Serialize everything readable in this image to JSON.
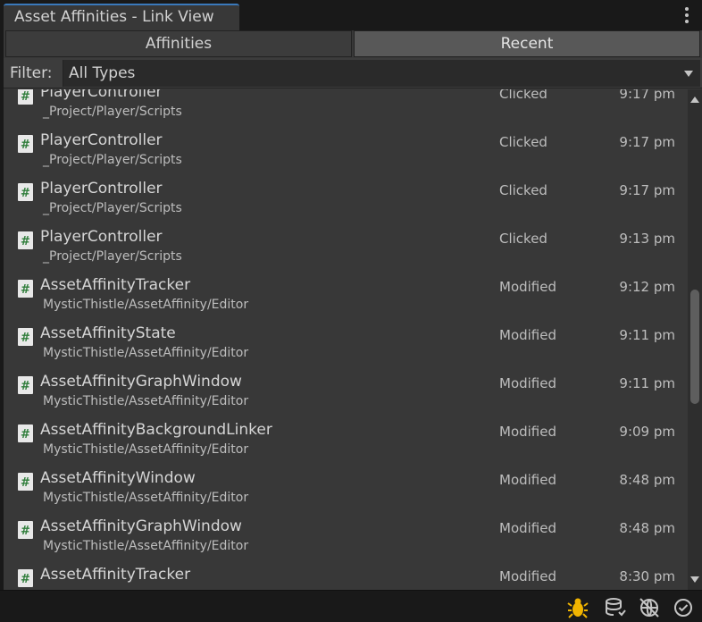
{
  "window": {
    "title": "Asset Affinities - Link View"
  },
  "tabs": {
    "affinities": "Affinities",
    "recent": "Recent",
    "active": "Recent"
  },
  "filter": {
    "label": "Filter:",
    "value": "All Types"
  },
  "rows": [
    {
      "name": "PlayerController",
      "path": "_Project/Player/Scripts",
      "action": "Clicked",
      "time": "9:17 pm",
      "icon": "csharp-script-icon"
    },
    {
      "name": "PlayerController",
      "path": "_Project/Player/Scripts",
      "action": "Clicked",
      "time": "9:17 pm",
      "icon": "csharp-script-icon"
    },
    {
      "name": "PlayerController",
      "path": "_Project/Player/Scripts",
      "action": "Clicked",
      "time": "9:17 pm",
      "icon": "csharp-script-icon"
    },
    {
      "name": "PlayerController",
      "path": "_Project/Player/Scripts",
      "action": "Clicked",
      "time": "9:13 pm",
      "icon": "csharp-script-icon"
    },
    {
      "name": "AssetAffinityTracker",
      "path": "MysticThistle/AssetAffinity/Editor",
      "action": "Modified",
      "time": "9:12 pm",
      "icon": "csharp-script-icon"
    },
    {
      "name": "AssetAffinityState",
      "path": "MysticThistle/AssetAffinity/Editor",
      "action": "Modified",
      "time": "9:11 pm",
      "icon": "csharp-script-icon"
    },
    {
      "name": "AssetAffinityGraphWindow",
      "path": "MysticThistle/AssetAffinity/Editor",
      "action": "Modified",
      "time": "9:11 pm",
      "icon": "csharp-script-icon"
    },
    {
      "name": "AssetAffinityBackgroundLinker",
      "path": "MysticThistle/AssetAffinity/Editor",
      "action": "Modified",
      "time": "9:09 pm",
      "icon": "csharp-script-icon"
    },
    {
      "name": "AssetAffinityWindow",
      "path": "MysticThistle/AssetAffinity/Editor",
      "action": "Modified",
      "time": "8:48 pm",
      "icon": "csharp-script-icon"
    },
    {
      "name": "AssetAffinityGraphWindow",
      "path": "MysticThistle/AssetAffinity/Editor",
      "action": "Modified",
      "time": "8:48 pm",
      "icon": "csharp-script-icon"
    },
    {
      "name": "AssetAffinityTracker",
      "path": "",
      "action": "Modified",
      "time": "8:30 pm",
      "icon": "csharp-script-icon"
    }
  ],
  "statusbar": {
    "icons": [
      "bug-icon",
      "database-sync-icon",
      "network-disabled-icon",
      "checkmark-circle-icon"
    ]
  },
  "colors": {
    "accent": "#3a79bb",
    "bug_icon": "#f0b400",
    "script_hash": "#2f7d3a"
  }
}
